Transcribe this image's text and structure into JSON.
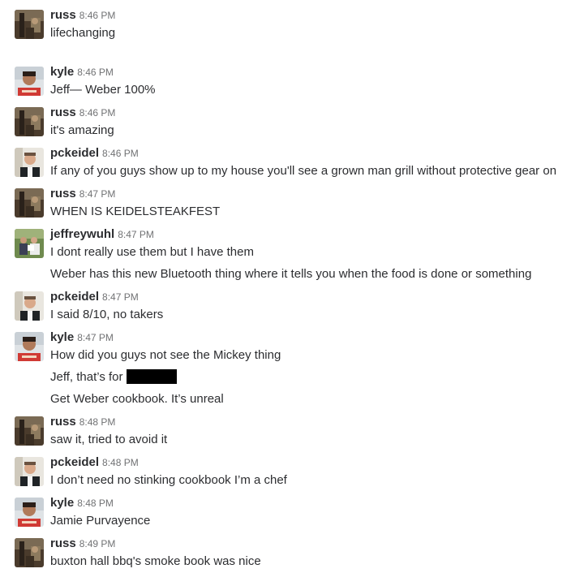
{
  "messages": [
    {
      "author": "russ",
      "avatar": "russ-avatar",
      "time": "8:46 PM",
      "lines": [
        "lifechanging"
      ]
    },
    {
      "author": "kyle",
      "avatar": "kyle-avatar",
      "time": "8:46 PM",
      "lines": [
        "Jeff— Weber 100%"
      ]
    },
    {
      "author": "russ",
      "avatar": "russ-avatar",
      "time": "8:46 PM",
      "lines": [
        "it's amazing"
      ]
    },
    {
      "author": "pckeidel",
      "avatar": "pckeidel-avatar",
      "time": "8:46 PM",
      "lines": [
        "If any of you guys show up to my house you'll see a grown man grill without protective gear on"
      ]
    },
    {
      "author": "russ",
      "avatar": "russ-avatar",
      "time": "8:47 PM",
      "lines": [
        "WHEN IS KEIDELSTEAKFEST"
      ]
    },
    {
      "author": "jeffreywuhl",
      "avatar": "jeffreywuhl-avatar",
      "time": "8:47 PM",
      "lines": [
        "I dont really use them but I have them",
        "Weber has this new Bluetooth thing where it tells you when the food is done or something"
      ]
    },
    {
      "author": "pckeidel",
      "avatar": "pckeidel-avatar",
      "time": "8:47 PM",
      "lines": [
        "I said 8/10, no takers"
      ]
    },
    {
      "author": "kyle",
      "avatar": "kyle-avatar",
      "time": "8:47 PM",
      "lines": [
        "How did you guys not see the Mickey thing",
        "Jeff, that’s for",
        "Get Weber cookbook. It’s unreal"
      ]
    },
    {
      "author": "russ",
      "avatar": "russ-avatar",
      "time": "8:48 PM",
      "lines": [
        "saw it, tried to avoid it"
      ]
    },
    {
      "author": "pckeidel",
      "avatar": "pckeidel-avatar",
      "time": "8:48 PM",
      "lines": [
        "I don’t need no stinking cookbook I’m a chef"
      ]
    },
    {
      "author": "kyle",
      "avatar": "kyle-avatar",
      "time": "8:48 PM",
      "lines": [
        "Jamie Purvayence"
      ]
    },
    {
      "author": "russ",
      "avatar": "russ-avatar",
      "time": "8:49 PM",
      "lines": [
        "buxton hall bbq's smoke book was nice"
      ]
    }
  ],
  "colors": {
    "author": "#2c2d30",
    "timestamp": "#717274",
    "text": "#2c2d30",
    "redaction": "#000000"
  }
}
